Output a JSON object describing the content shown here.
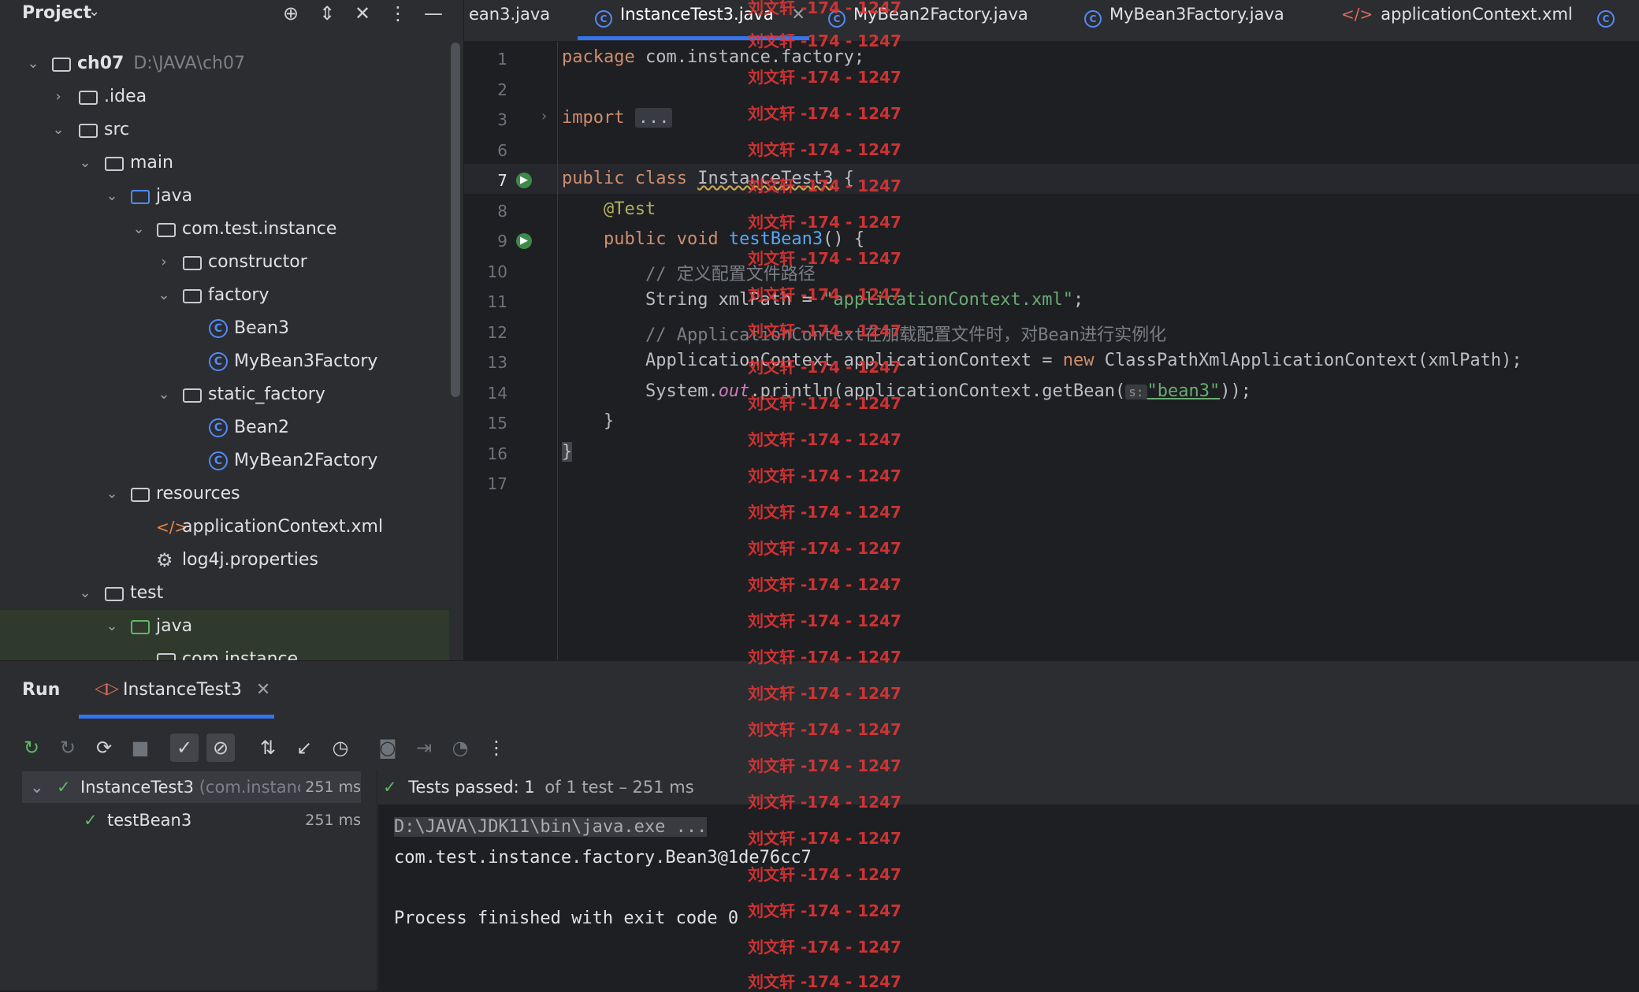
{
  "project": {
    "title": "Project",
    "root_name": "ch07",
    "root_path": "D:\\JAVA\\ch07",
    "tree": [
      {
        "label": "ch07"
      },
      {
        "label": ".idea"
      },
      {
        "label": "src"
      },
      {
        "label": "main"
      },
      {
        "label": "java"
      },
      {
        "label": "com.test.instance"
      },
      {
        "label": "constructor"
      },
      {
        "label": "factory"
      },
      {
        "label": "Bean3"
      },
      {
        "label": "MyBean3Factory"
      },
      {
        "label": "static_factory"
      },
      {
        "label": "Bean2"
      },
      {
        "label": "MyBean2Factory"
      },
      {
        "label": "resources"
      },
      {
        "label": "applicationContext.xml"
      },
      {
        "label": "log4j.properties"
      },
      {
        "label": "test"
      },
      {
        "label": "java"
      },
      {
        "label": "com.instance"
      }
    ]
  },
  "tabs": [
    {
      "label": "ean3.java"
    },
    {
      "label": "InstanceTest3.java"
    },
    {
      "label": "MyBean2Factory.java"
    },
    {
      "label": "MyBean3Factory.java"
    },
    {
      "label": "applicationContext.xml"
    }
  ],
  "editor": {
    "line_numbers": [
      "1",
      "2",
      "3",
      "6",
      "7",
      "8",
      "9",
      "10",
      "11",
      "12",
      "13",
      "14",
      "15",
      "16",
      "17"
    ],
    "code": {
      "l1_kw": "package",
      "l1_rest": " com.instance.factory;",
      "l3_kw": "import",
      "l3_fold": "...",
      "l7_kw": "public class",
      "l7_class": "InstanceTest3",
      "l7_brace": " {",
      "l8_ann": "@Test",
      "l9_kw": "public void",
      "l9_fn": "testBean3",
      "l9_rest": "() {",
      "l10_cmt": "// 定义配置文件路径",
      "l11_a": "String xmlPath = ",
      "l11_str": "\"applicationContext.xml\"",
      "l11_b": ";",
      "l12_cmt": "// ApplicationContext在加载配置文件时，对Bean进行实例化",
      "l13_a": "ApplicationContext applicationContext = ",
      "l13_kw": "new",
      "l13_b": " ClassPathXmlApplicationContext(xmlPath);",
      "l14_a": "System.",
      "l14_out": "out",
      "l14_b": ".println(applicationContext.getBean(",
      "l14_hint": "s:",
      "l14_str": "\"bean3\"",
      "l14_c": "));",
      "l15": "}",
      "l16": "}"
    }
  },
  "watermark": "刘文轩 -174 - 1247",
  "run": {
    "title": "Run",
    "tab_label": "InstanceTest3",
    "tests": [
      {
        "name": "InstanceTest3",
        "hint": "(com.instance",
        "time": "251 ms"
      },
      {
        "name": "testBean3",
        "hint": "",
        "time": "251 ms"
      }
    ],
    "status": {
      "passed": "Tests passed: 1",
      "rest": "of 1 test – 251 ms"
    },
    "console": [
      "D:\\JAVA\\JDK11\\bin\\java.exe ...",
      "com.test.instance.factory.Bean3@1de76cc7",
      "",
      "Process finished with exit code 0"
    ]
  }
}
